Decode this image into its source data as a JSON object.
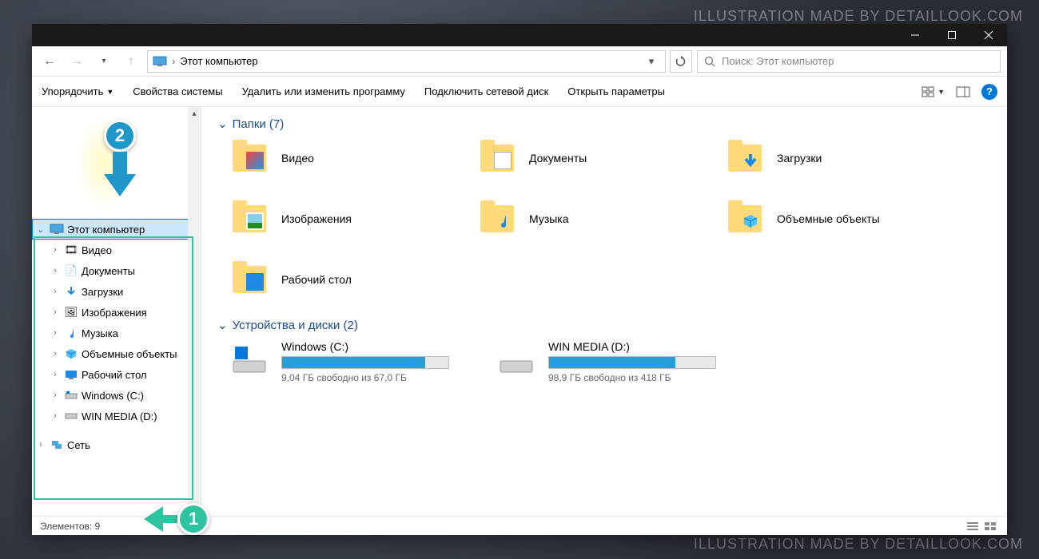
{
  "watermark": "ILLUSTRATION MADE BY DETAILLOOK.COM",
  "breadcrumb": "Этот компьютер",
  "search_placeholder": "Поиск: Этот компьютер",
  "toolbar": {
    "organize": "Упорядочить",
    "properties": "Свойства системы",
    "uninstall": "Удалить или изменить программу",
    "map": "Подключить сетевой диск",
    "open_params": "Открыть параметры"
  },
  "tree": {
    "this_pc": "Этот компьютер",
    "items": [
      "Видео",
      "Документы",
      "Загрузки",
      "Изображения",
      "Музыка",
      "Объемные объекты",
      "Рабочий стол",
      "Windows (C:)",
      "WIN MEDIA (D:)"
    ],
    "network": "Сеть"
  },
  "sections": {
    "folders_title": "Папки (7)",
    "drives_title": "Устройства и диски (2)"
  },
  "folders": [
    "Видео",
    "Документы",
    "Загрузки",
    "Изображения",
    "Музыка",
    "Объемные объекты",
    "Рабочий стол"
  ],
  "drives": [
    {
      "name": "Windows (C:)",
      "free": "9,04 ГБ свободно из 67,0 ГБ",
      "pct": 86
    },
    {
      "name": "WIN MEDIA (D:)",
      "free": "98,9 ГБ свободно из 418 ГБ",
      "pct": 76
    }
  ],
  "status_items": "Элементов: 9",
  "annotations": {
    "one": "1",
    "two": "2"
  }
}
